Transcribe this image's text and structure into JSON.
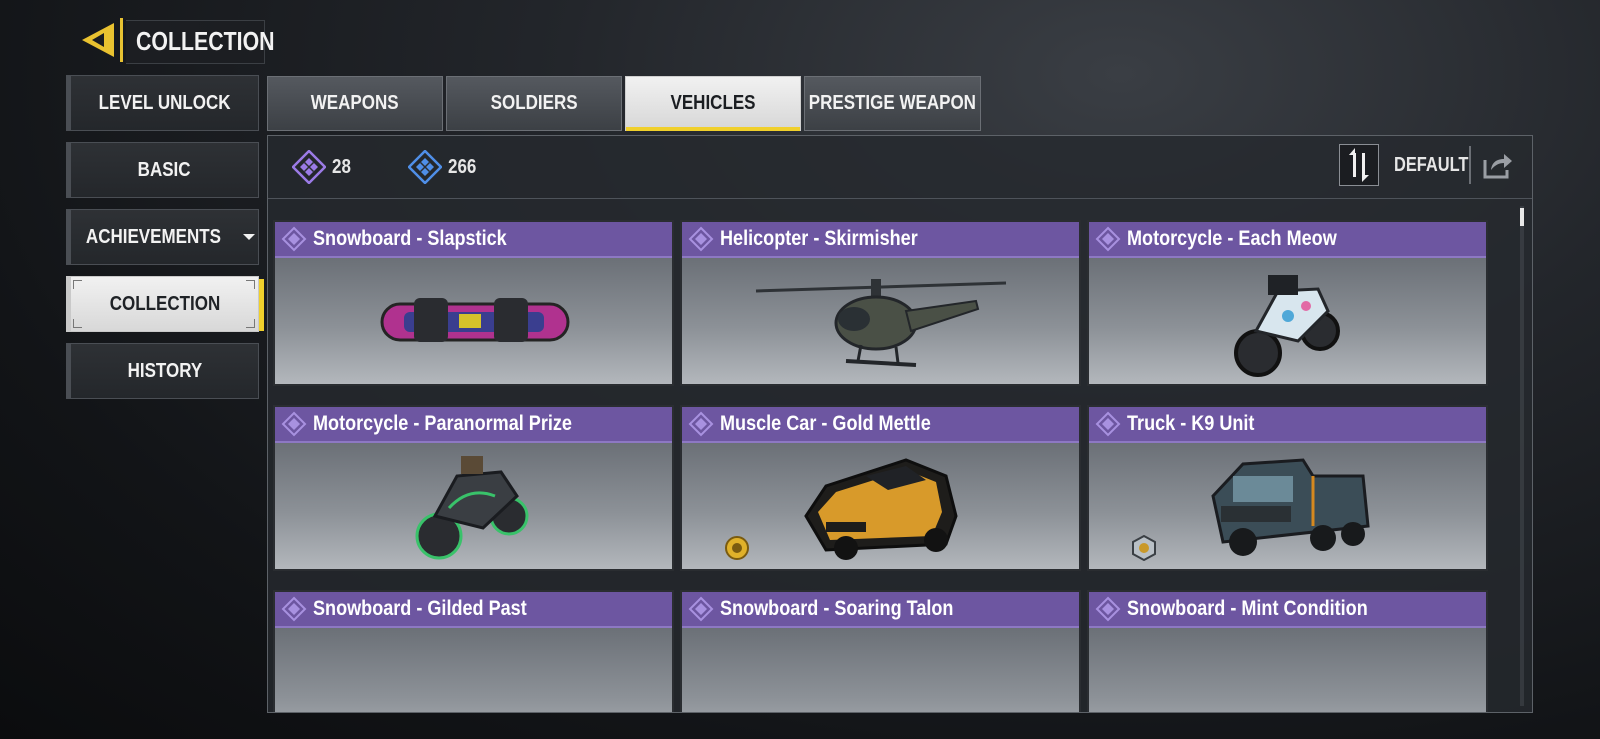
{
  "header": {
    "title": "COLLECTION"
  },
  "sidebar": {
    "items": [
      {
        "label": "LEVEL UNLOCK"
      },
      {
        "label": "BASIC"
      },
      {
        "label": "ACHIEVEMENTS"
      },
      {
        "label": "COLLECTION",
        "active": true
      },
      {
        "label": "HISTORY"
      }
    ]
  },
  "tabs": [
    {
      "label": "WEAPONS"
    },
    {
      "label": "SOLDIERS"
    },
    {
      "label": "VEHICLES",
      "active": true
    },
    {
      "label": "PRESTIGE WEAPON"
    }
  ],
  "currency": {
    "purple_amount": "28",
    "blue_amount": "266"
  },
  "sort": {
    "label": "DEFAULT"
  },
  "cards": [
    {
      "title": "Snowboard - Slapstick",
      "icon": "snowboard"
    },
    {
      "title": "Helicopter - Skirmisher",
      "icon": "helicopter"
    },
    {
      "title": "Motorcycle - Each Meow",
      "icon": "motorcycle"
    },
    {
      "title": "Motorcycle - Paranormal Prize",
      "icon": "motorcycle"
    },
    {
      "title": "Muscle Car - Gold Mettle",
      "icon": "car",
      "badge": "gold-badge"
    },
    {
      "title": "Truck - K9 Unit",
      "icon": "truck",
      "badge": "silver-badge"
    },
    {
      "title": "Snowboard - Gilded Past",
      "icon": "snowboard"
    },
    {
      "title": "Snowboard - Soaring Talon",
      "icon": "snowboard"
    },
    {
      "title": "Snowboard - Mint Condition",
      "icon": "snowboard"
    }
  ],
  "colors": {
    "accent": "#f0d02c",
    "card_header": "#6d56a1",
    "purple_currency": "#9b7be6",
    "blue_currency": "#4f8fe8"
  }
}
